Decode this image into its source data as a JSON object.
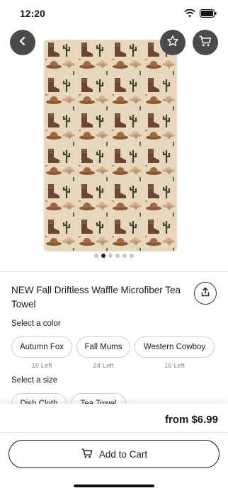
{
  "status_bar": {
    "time": "12:20",
    "icons": [
      "wifi-icon",
      "battery-icon"
    ]
  },
  "header": {
    "icons": [
      "back-arrow-icon",
      "star-icon",
      "cart-icon"
    ]
  },
  "gallery": {
    "total_images": 6,
    "active_index": 1,
    "pattern": "western cowboy boots, hats and cactus print"
  },
  "product": {
    "title": "NEW Fall Driftless Waffle Microfiber Tea Towel"
  },
  "colors": {
    "label": "Select a color",
    "options": [
      {
        "name": "Autumn Fox",
        "stock": "16 Left"
      },
      {
        "name": "Fall Mums",
        "stock": "24 Left"
      },
      {
        "name": "Western Cowboy",
        "stock": "16 Left"
      }
    ]
  },
  "sizes": {
    "label": "Select a size",
    "options": [
      {
        "name": "Dish Cloth"
      },
      {
        "name": "Tea Towel"
      }
    ]
  },
  "footer": {
    "price": "from $6.99",
    "add_to_cart": "Add to Cart"
  },
  "colors_theme": {
    "button_dark": "#4a4a4a",
    "text": "#1a1a1a",
    "muted": "#8a8a8a",
    "border": "#cfcfcf"
  }
}
